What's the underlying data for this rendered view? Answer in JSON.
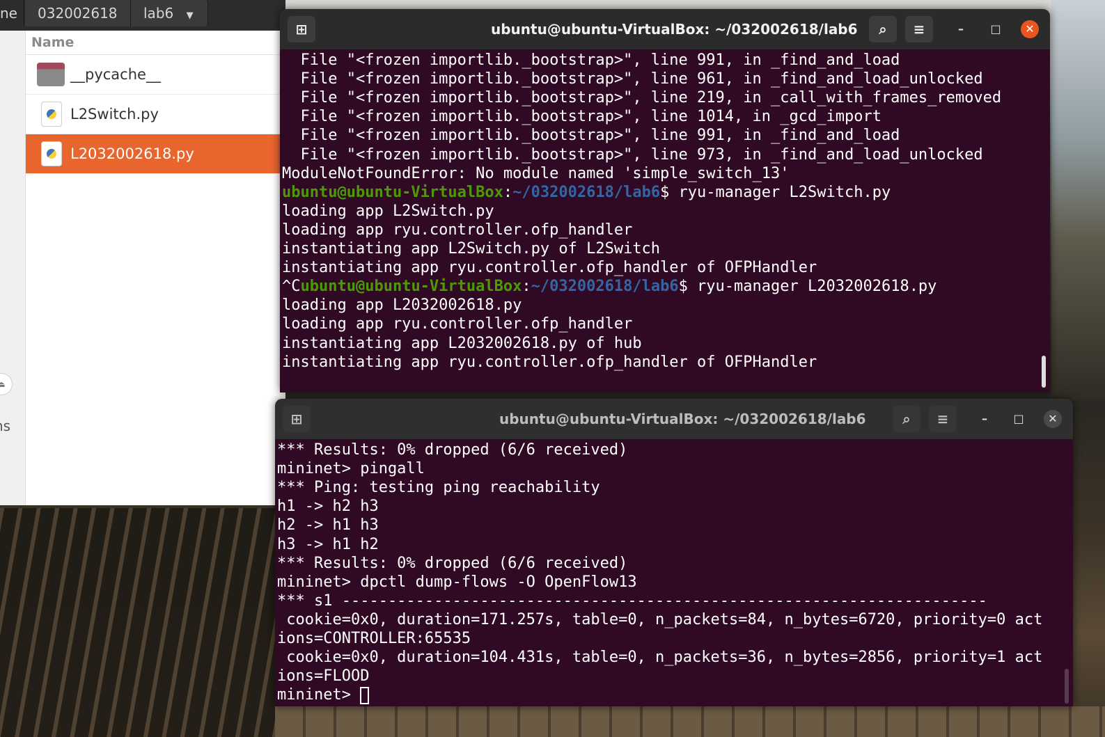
{
  "file_manager": {
    "breadcrumbs": [
      "ne",
      "032002618",
      "lab6"
    ],
    "column_header": "Name",
    "files": [
      {
        "name": "__pycache__",
        "type": "folder",
        "selected": false
      },
      {
        "name": "L2Switch.py",
        "type": "python",
        "selected": false
      },
      {
        "name": "L2032002618.py",
        "type": "python",
        "selected": true
      }
    ],
    "sidebar_partial_label": "ns"
  },
  "terminal_top": {
    "title": "ubuntu@ubuntu-VirtualBox: ~/032002618/lab6",
    "lines": [
      {
        "text": "  File \"<frozen importlib._bootstrap>\", line 991, in _find_and_load"
      },
      {
        "text": "  File \"<frozen importlib._bootstrap>\", line 961, in _find_and_load_unlocked"
      },
      {
        "text": "  File \"<frozen importlib._bootstrap>\", line 219, in _call_with_frames_removed"
      },
      {
        "text": "  File \"<frozen importlib._bootstrap>\", line 1014, in _gcd_import"
      },
      {
        "text": "  File \"<frozen importlib._bootstrap>\", line 991, in _find_and_load"
      },
      {
        "text": "  File \"<frozen importlib._bootstrap>\", line 973, in _find_and_load_unlocked"
      },
      {
        "text": "ModuleNotFoundError: No module named 'simple_switch_13'"
      },
      {
        "pre": "",
        "user": "ubuntu@ubuntu-VirtualBox",
        "path": "~/032002618/lab6",
        "cmd": "$ ryu-manager L2Switch.py"
      },
      {
        "text": "loading app L2Switch.py"
      },
      {
        "text": "loading app ryu.controller.ofp_handler"
      },
      {
        "text": "instantiating app L2Switch.py of L2Switch"
      },
      {
        "text": "instantiating app ryu.controller.ofp_handler of OFPHandler"
      },
      {
        "pre": "^C",
        "user": "ubuntu@ubuntu-VirtualBox",
        "path": "~/032002618/lab6",
        "cmd": "$ ryu-manager L2032002618.py"
      },
      {
        "text": "loading app L2032002618.py"
      },
      {
        "text": "loading app ryu.controller.ofp_handler"
      },
      {
        "text": "instantiating app L2032002618.py of hub"
      },
      {
        "text": "instantiating app ryu.controller.ofp_handler of OFPHandler"
      }
    ]
  },
  "terminal_bottom": {
    "title": "ubuntu@ubuntu-VirtualBox: ~/032002618/lab6",
    "lines": [
      {
        "text": "*** Results: 0% dropped (6/6 received)"
      },
      {
        "text": "mininet> pingall"
      },
      {
        "text": "*** Ping: testing ping reachability"
      },
      {
        "text": "h1 -> h2 h3"
      },
      {
        "text": "h2 -> h1 h3"
      },
      {
        "text": "h3 -> h1 h2"
      },
      {
        "text": "*** Results: 0% dropped (6/6 received)"
      },
      {
        "text": "mininet> dpctl dump-flows -O OpenFlow13"
      },
      {
        "text": "*** s1 ----------------------------------------------------------------------"
      },
      {
        "text": " cookie=0x0, duration=171.257s, table=0, n_packets=84, n_bytes=6720, priority=0 act"
      },
      {
        "text": "ions=CONTROLLER:65535"
      },
      {
        "text": " cookie=0x0, duration=104.431s, table=0, n_packets=36, n_bytes=2856, priority=1 act"
      },
      {
        "text": "ions=FLOOD"
      },
      {
        "text": "mininet> ",
        "cursor": true
      }
    ]
  },
  "icons": {
    "new_tab": "new-tab-icon",
    "search": "search-icon",
    "menu": "hamburger-menu-icon",
    "minimize": "minimize-icon",
    "maximize": "maximize-icon",
    "close": "close-icon"
  },
  "colors": {
    "terminal_bg": "#300a24",
    "prompt_user": "#4e9a06",
    "prompt_path": "#3465a4",
    "selection": "#e9652e",
    "close_button": "#e95420"
  }
}
